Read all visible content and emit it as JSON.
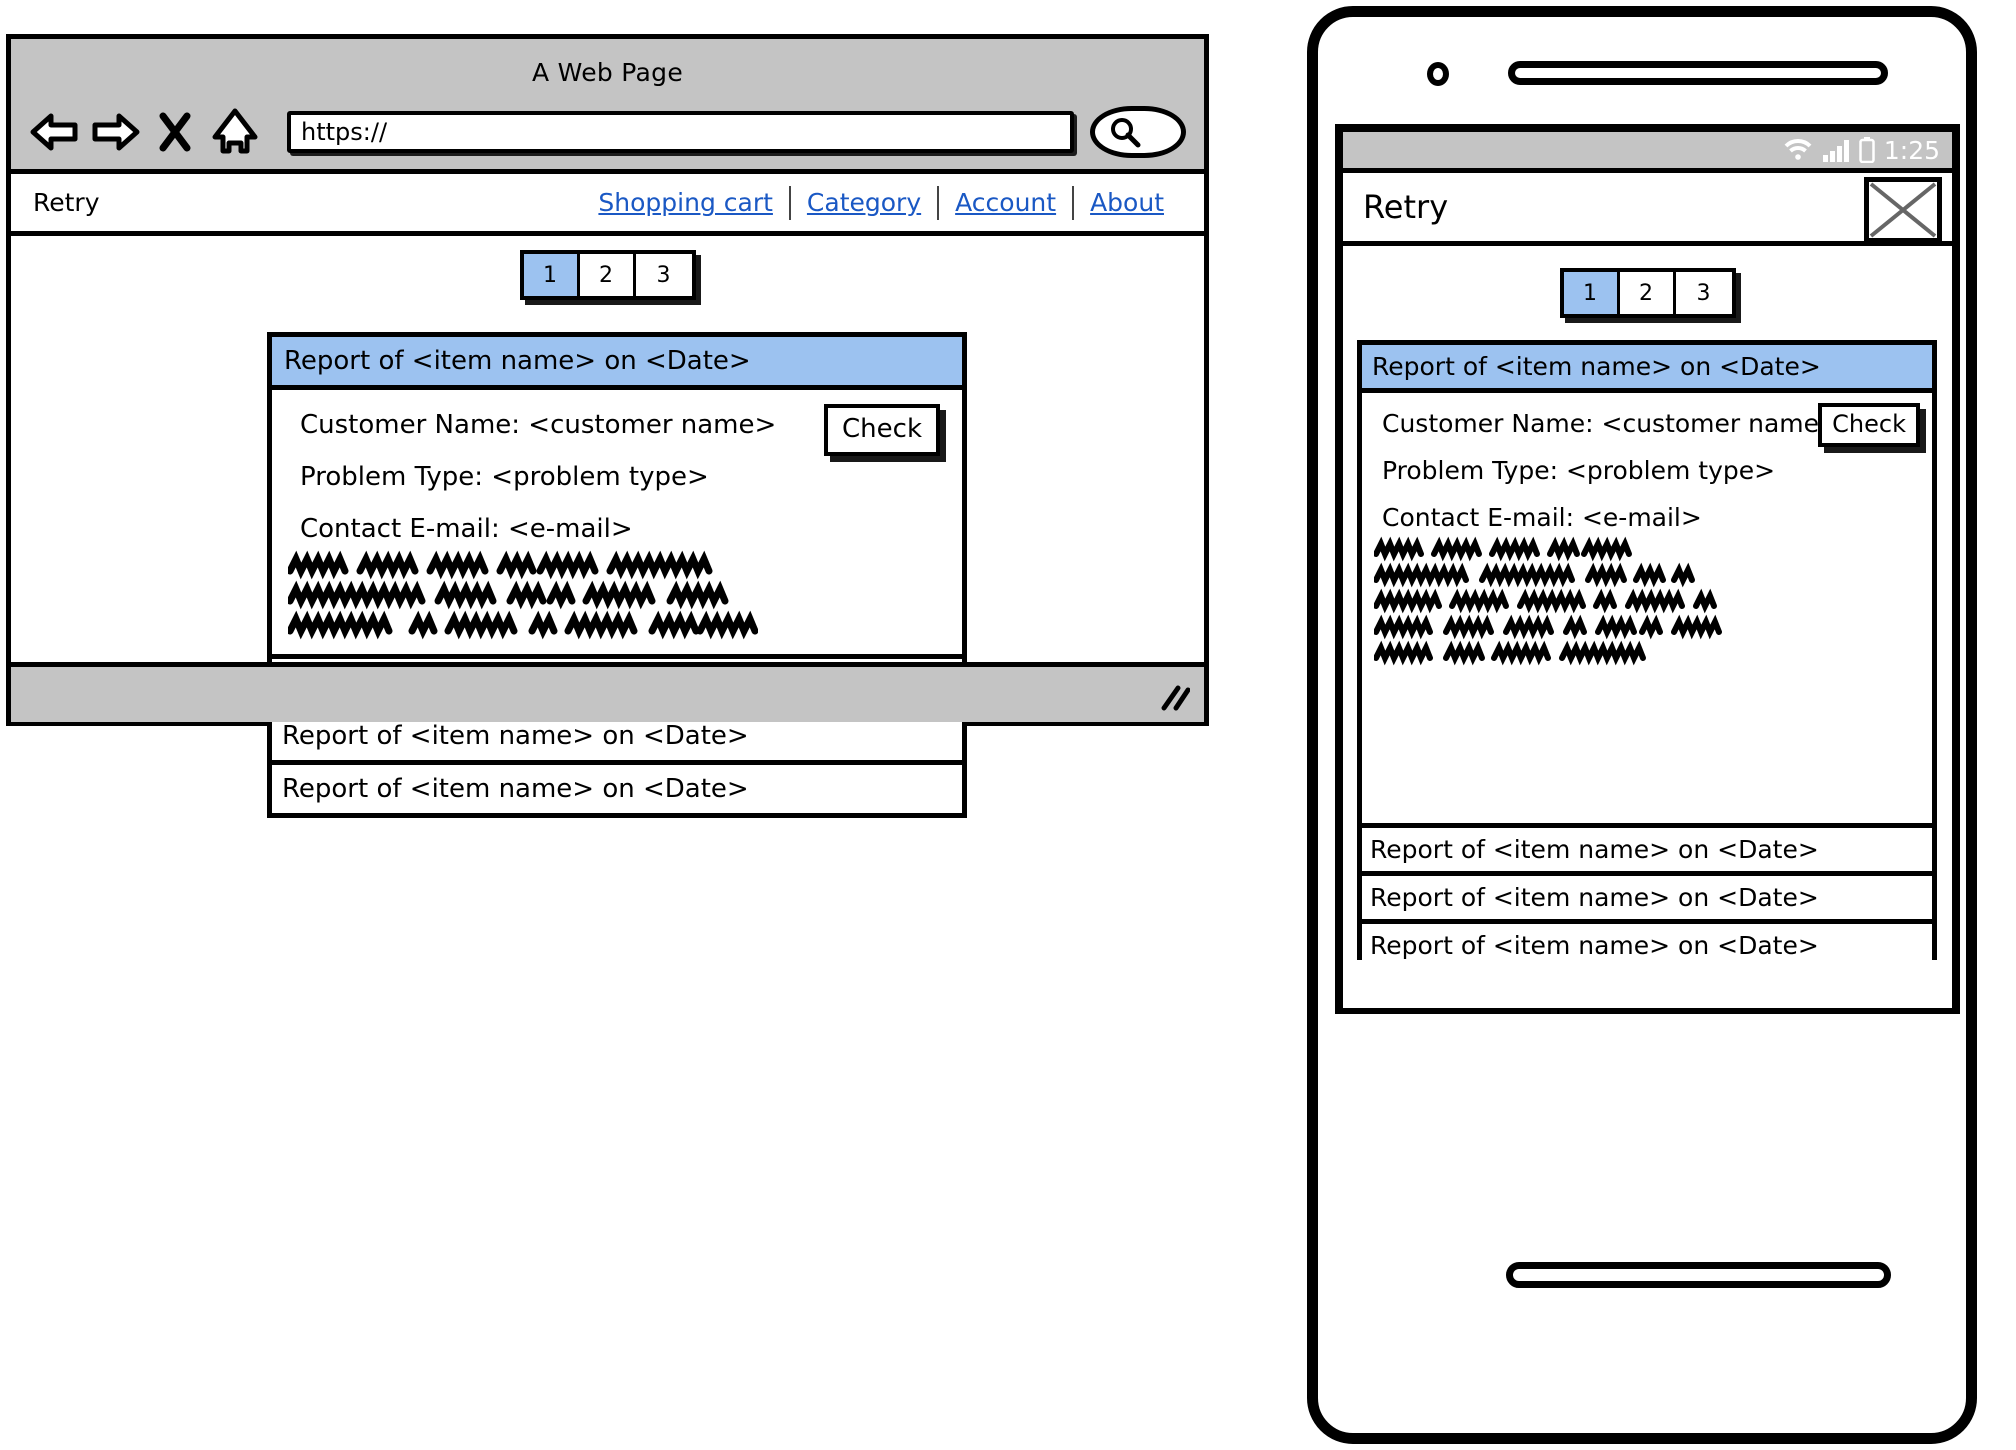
{
  "browser": {
    "title": "A Web Page",
    "url_value": "https://",
    "icons": {
      "back": "back-arrow-icon",
      "forward": "forward-arrow-icon",
      "stop": "close-x-icon",
      "home": "home-icon",
      "search": "search-icon",
      "resize": "resize-grip-icon"
    }
  },
  "site_nav": {
    "brand": "Retry",
    "links": [
      {
        "label": "Shopping cart"
      },
      {
        "label": "Category"
      },
      {
        "label": "Account"
      },
      {
        "label": "About"
      }
    ]
  },
  "pagination": {
    "pages": [
      "1",
      "2",
      "3"
    ],
    "active": "1"
  },
  "report_panel": {
    "header": "Report of <item name> on <Date>",
    "fields": [
      "Customer Name: <customer name>",
      "Problem Type: <problem type>",
      "Contact E-mail: <e-mail>"
    ],
    "check_button": "Check",
    "collapsed_rows": [
      "Report of <item name> on <Date>",
      "Report of <item name> on <Date>",
      "Report of <item name> on <Date>"
    ]
  },
  "phone": {
    "status": {
      "clock": "1:25",
      "icons": [
        "wifi-icon",
        "signal-icon",
        "battery-icon"
      ]
    },
    "appbar": {
      "title": "Retry",
      "image_placeholder": "image-placeholder-icon"
    }
  },
  "colors": {
    "accent_blue": "#9cc2f0",
    "link_blue": "#1a58c4",
    "chrome_gray": "#c4c4c4",
    "ink": "#000000"
  }
}
